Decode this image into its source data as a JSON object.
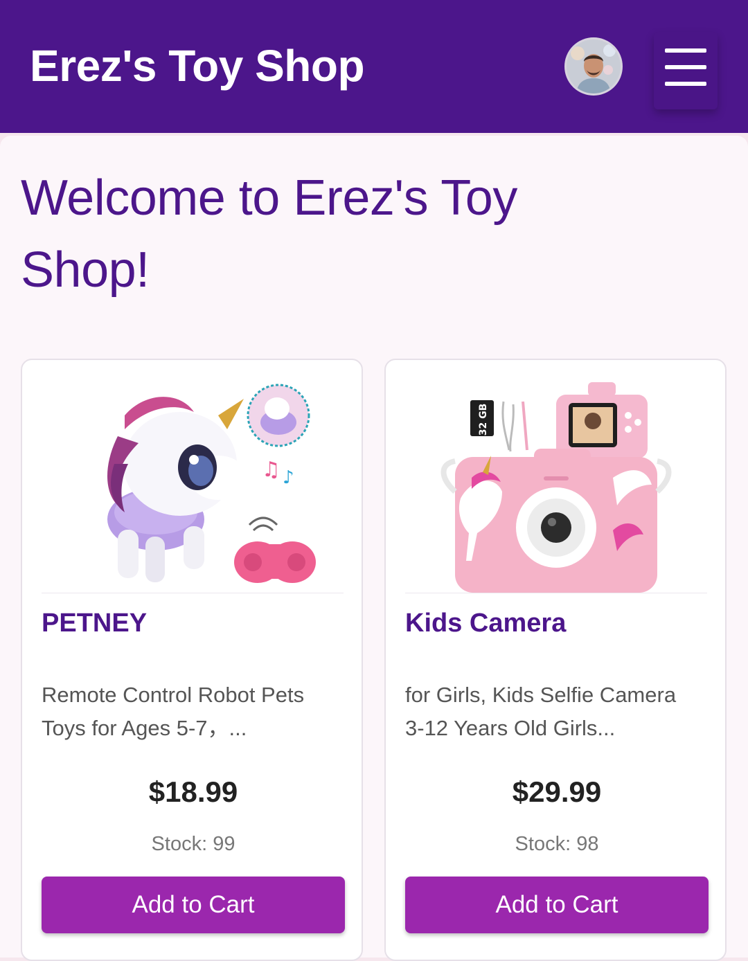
{
  "header": {
    "title": "Erez's Toy Shop"
  },
  "main": {
    "welcome_heading": "Welcome to Erez's Toy Shop!"
  },
  "products": [
    {
      "name": "PETNEY",
      "description": "Remote Control Robot Pets Toys for Ages 5-7，...",
      "price": "$18.99",
      "stock": "Stock: 99",
      "button_label": "Add to Cart"
    },
    {
      "name": "Kids Camera",
      "description": "for Girls, Kids Selfie Camera 3-12 Years Old Girls...",
      "price": "$29.99",
      "stock": "Stock: 98",
      "button_label": "Add to Cart"
    }
  ],
  "camera_image_badge": "32 GB",
  "colors": {
    "header_bg": "#4c168b",
    "accent": "#9b27ad",
    "heading_text": "#4c168b"
  },
  "icons": {
    "menu": "hamburger-menu-icon",
    "avatar": "user-avatar"
  }
}
